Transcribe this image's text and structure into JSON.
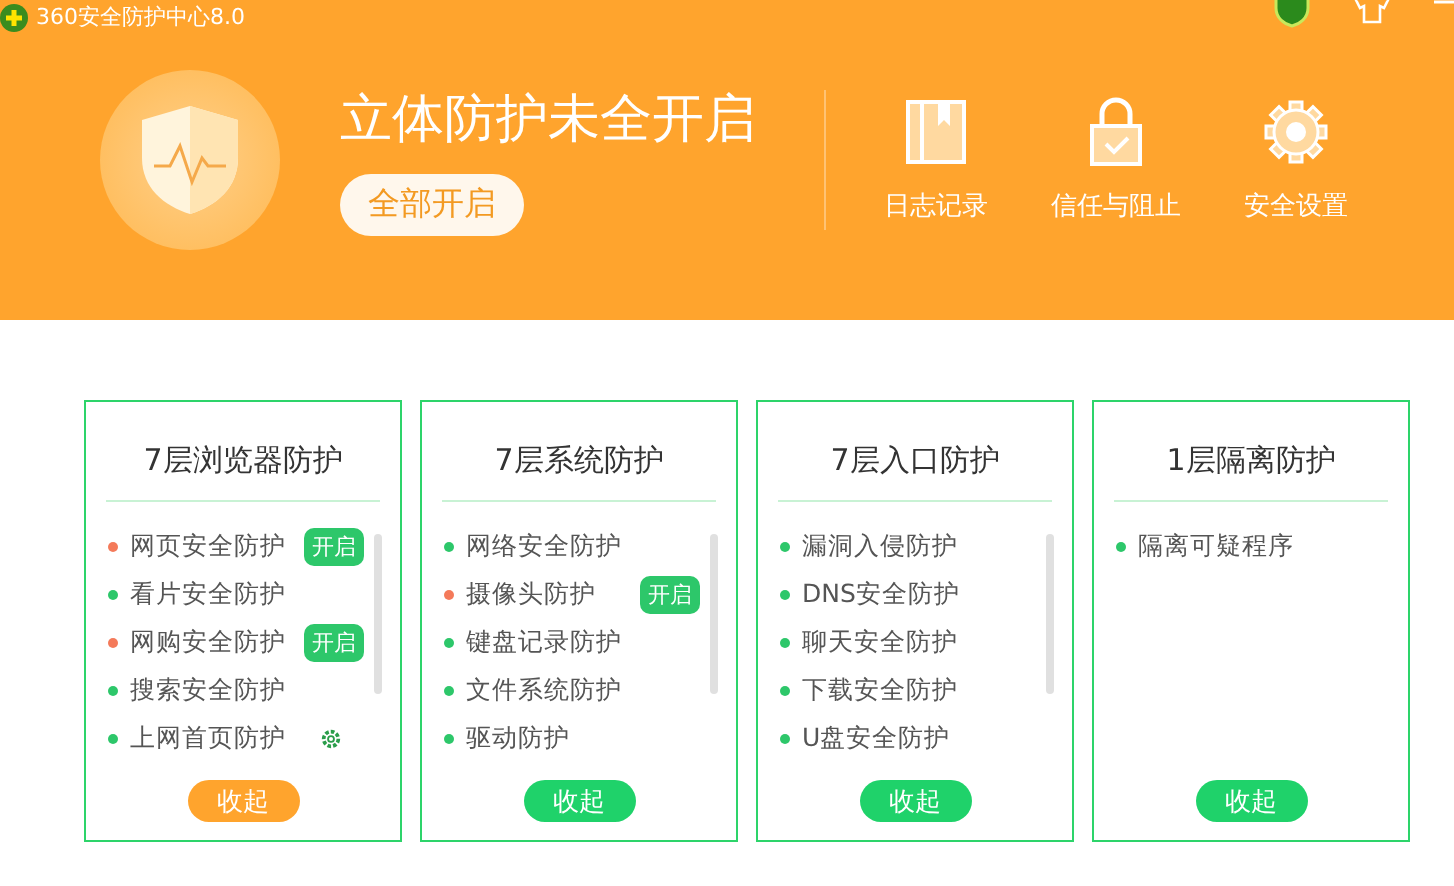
{
  "window": {
    "title": "360安全防护中心8.0"
  },
  "header": {
    "status": "立体防护未全开启",
    "enable_all_button": "全部开启",
    "tools": [
      {
        "kind": "log",
        "label": "日志记录"
      },
      {
        "kind": "trust",
        "label": "信任与阻止"
      },
      {
        "kind": "settings",
        "label": "安全设置"
      }
    ]
  },
  "cards": [
    {
      "title": "7层浏览器防护",
      "collapse_button": "收起",
      "warning": true,
      "scrollbar": true,
      "items": [
        {
          "label": "网页安全防护",
          "enabled": false,
          "action": "开启"
        },
        {
          "label": "看片安全防护",
          "enabled": true
        },
        {
          "label": "网购安全防护",
          "enabled": false,
          "action": "开启"
        },
        {
          "label": "搜索安全防护",
          "enabled": true
        },
        {
          "label": "上网首页防护",
          "enabled": true,
          "settings": true
        }
      ]
    },
    {
      "title": "7层系统防护",
      "collapse_button": "收起",
      "warning": false,
      "scrollbar": true,
      "items": [
        {
          "label": "网络安全防护",
          "enabled": true
        },
        {
          "label": "摄像头防护",
          "enabled": false,
          "action": "开启"
        },
        {
          "label": "键盘记录防护",
          "enabled": true
        },
        {
          "label": "文件系统防护",
          "enabled": true
        },
        {
          "label": "驱动防护",
          "enabled": true
        }
      ]
    },
    {
      "title": "7层入口防护",
      "collapse_button": "收起",
      "warning": false,
      "scrollbar": true,
      "items": [
        {
          "label": "漏洞入侵防护",
          "enabled": true
        },
        {
          "label": "DNS安全防护",
          "enabled": true
        },
        {
          "label": "聊天安全防护",
          "enabled": true
        },
        {
          "label": "下载安全防护",
          "enabled": true
        },
        {
          "label": "U盘安全防护",
          "enabled": true
        }
      ]
    },
    {
      "title": "1层隔离防护",
      "collapse_button": "收起",
      "warning": false,
      "scrollbar": false,
      "items": [
        {
          "label": "隔离可疑程序",
          "enabled": true
        }
      ]
    }
  ]
}
